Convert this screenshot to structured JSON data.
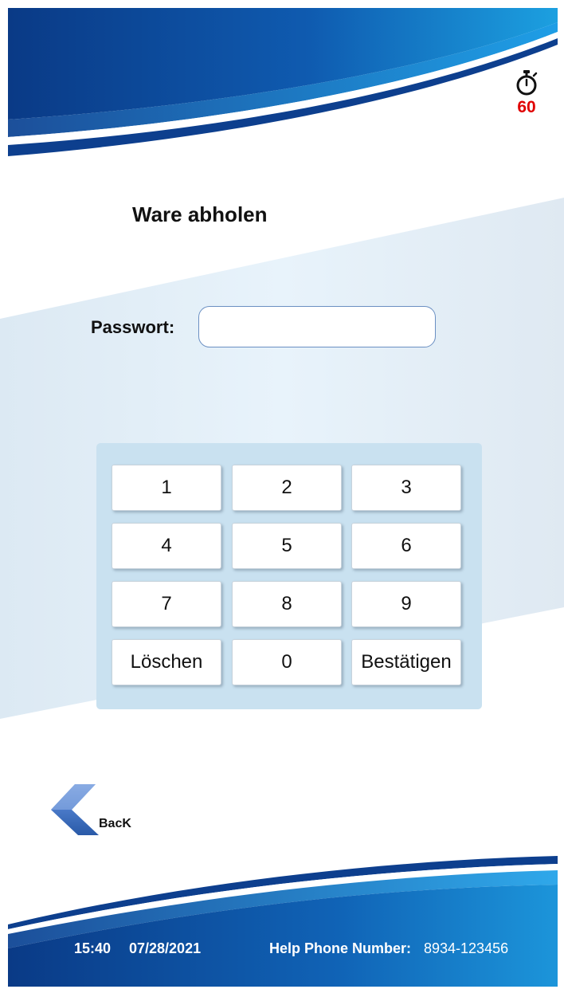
{
  "timer": {
    "icon": "stopwatch-icon",
    "value": "60",
    "color": "#e00000"
  },
  "page": {
    "title": "Ware abholen"
  },
  "password": {
    "label": "Passwort:",
    "value": "",
    "placeholder": ""
  },
  "keypad": {
    "keys": [
      "1",
      "2",
      "3",
      "4",
      "5",
      "6",
      "7",
      "8",
      "9",
      "Löschen",
      "0",
      "Bestätigen"
    ]
  },
  "back": {
    "label": "BacK",
    "icon": "back-arrow-icon"
  },
  "footer": {
    "time": "15:40",
    "date": "07/28/2021",
    "help_label": "Help Phone Number:",
    "help_number": "8934-123456"
  },
  "colors": {
    "brand_dark": "#0a3f8c",
    "brand_light": "#1ea5e6",
    "keypad_bg": "#c9e1f0"
  }
}
